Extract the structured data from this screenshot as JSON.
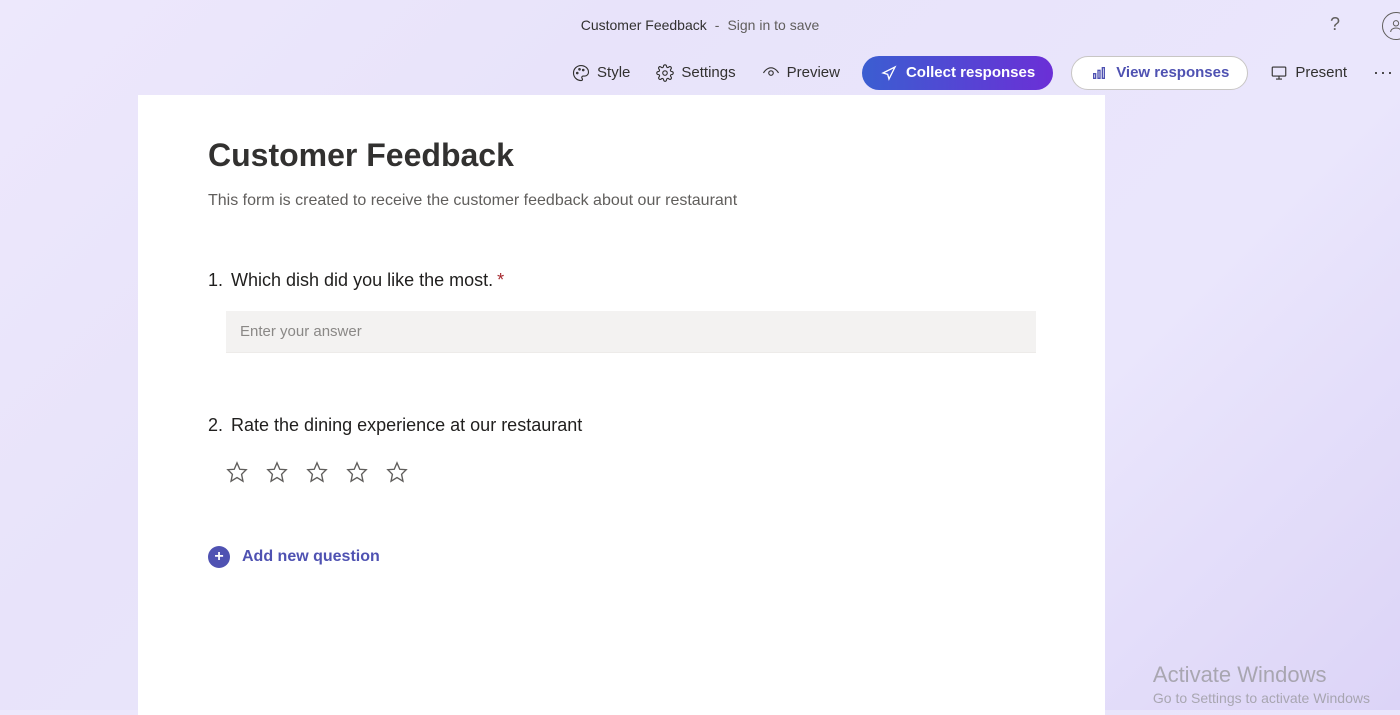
{
  "header": {
    "form_name": "Customer Feedback",
    "separator": "-",
    "signin_text": "Sign in to save"
  },
  "toolbar": {
    "style_label": "Style",
    "settings_label": "Settings",
    "preview_label": "Preview",
    "collect_label": "Collect responses",
    "view_label": "View responses",
    "present_label": "Present"
  },
  "form": {
    "title": "Customer Feedback",
    "description": "This form is created to receive the customer feedback about our restaurant",
    "questions": [
      {
        "number": "1.",
        "text": "Which dish did you like the most.",
        "required": true,
        "placeholder": "Enter your answer"
      },
      {
        "number": "2.",
        "text": "Rate the dining experience at our restaurant",
        "required": false,
        "stars": 5
      }
    ],
    "add_question_label": "Add new question"
  },
  "watermark": {
    "title": "Activate Windows",
    "subtitle": "Go to Settings to activate Windows"
  }
}
